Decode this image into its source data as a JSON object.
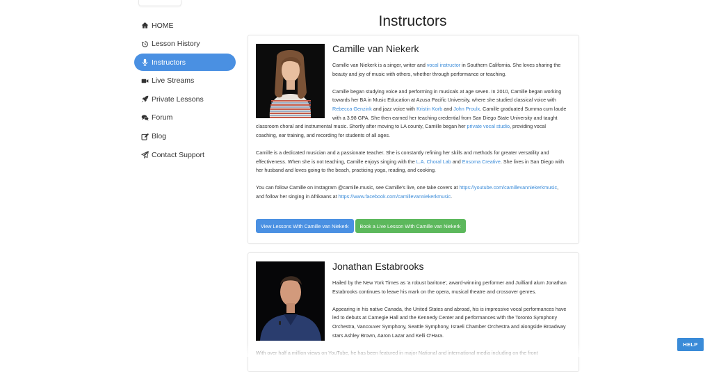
{
  "sidebar": {
    "items": [
      {
        "label": "HOME",
        "icon": "home-icon"
      },
      {
        "label": "Lesson History",
        "icon": "history-icon"
      },
      {
        "label": "Instructors",
        "icon": "microphone-icon",
        "active": true
      },
      {
        "label": "Live Streams",
        "icon": "video-camera-icon"
      },
      {
        "label": "Private Lessons",
        "icon": "rocket-icon"
      },
      {
        "label": "Forum",
        "icon": "comments-icon"
      },
      {
        "label": "Blog",
        "icon": "edit-icon"
      },
      {
        "label": "Contact Support",
        "icon": "paper-plane-icon"
      }
    ]
  },
  "page": {
    "title": "Instructors"
  },
  "instructors": [
    {
      "name": "Camille van Niekerk",
      "p1": {
        "a": "Camille van Niekerk is a singer, writer and ",
        "link": "vocal instructor",
        "b": " in Southern California. She loves sharing the beauty and joy of music with others, whether through performance or teaching."
      },
      "p2": {
        "a": "Camille began studying voice and performing in musicals at age seven. In 2010, Camille began working towards her BA in Music Education at Azusa Pacific University, where she studied classical voice with ",
        "l1": "Rebecca Genzink",
        "b": " and jazz voice with ",
        "l2": "Kristin Korb",
        "c": " and ",
        "l3": "John Proulx",
        "d": ". Camille graduated Summa cum laude with a 3.98 GPA. She then earned her teaching credential from San Diego State University and taught classroom choral and instrumental music. Shortly after moving to LA county, Camille began her ",
        "l4": "private vocal studio",
        "e": ", providing vocal coaching, ear training, and recording for students of all ages."
      },
      "p3": {
        "a": "Camille is a dedicated musician and a passionate teacher. She is constantly refining her skills and methods for greater versatility and effectiveness. When she is not teaching, Camille enjoys singing with the ",
        "l1": "L.A. Choral Lab",
        "b": " and ",
        "l2": "Ensoma Creative",
        "c": ". She lives in San Diego with her husband and loves going to the beach, practicing yoga, reading, and cooking."
      },
      "p4": {
        "a": "You can follow Camille on Instagram @camille.music, see Camille's live, one take covers at ",
        "l1": "https://youtube.com/camillevanniekerkmusic",
        "b": ", and follow her singing in Afrikaans at ",
        "l2": "https://www.facebook.com/camillevanniekerkmusic",
        "c": "."
      },
      "btn_view": "View Lessons With Camille van Niekerk",
      "btn_book": "Book a Live Lesson With Camille van Niekerk"
    },
    {
      "name": "Jonathan Estabrooks",
      "p1": "Hailed by the New York Times as 'a robust baritone', award-winning performer and Juilliard alum Jonathan Estabrooks continues to leave his mark on the opera, musical theatre and crossover genres.",
      "p2": "Appearing in his native Canada, the United States and abroad, his is impressive vocal performances have led to debuts at Carnegie Hall and the Kennedy Center and performances with the Toronto Symphony Orchestra, Vancouver Symphony, Seattle Symphony, Israeli Chamber Orchestra and alongside Broadway stars Ashley Brown, Aaron Lazar and Kelli O'Hara.",
      "p3": "With over half a million views on YouTube, he has been featured in major National and international media including on the front"
    }
  ],
  "help": {
    "label": "HELP"
  },
  "colors": {
    "accent": "#4a90e2",
    "link": "#3a8bd8",
    "success": "#5cb85c",
    "text": "#333333"
  }
}
